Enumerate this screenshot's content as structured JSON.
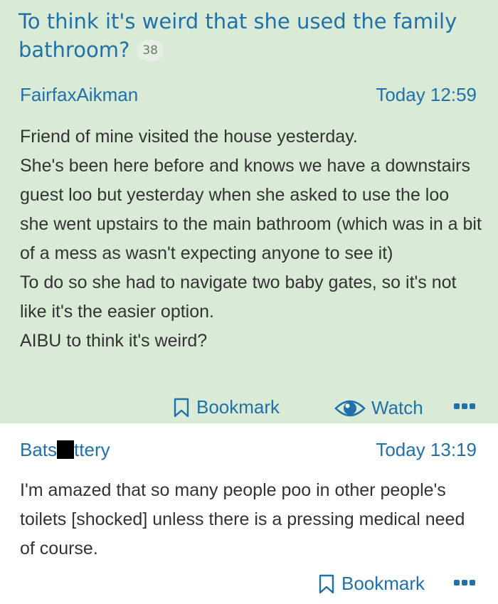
{
  "thread": {
    "title": "To think it's weird that she used the family bathroom?",
    "reply_count": "38"
  },
  "op": {
    "author": "FairfaxAikman",
    "time": "Today 12:59",
    "body_lines": [
      "Friend of mine visited the house yesterday.",
      "She's been here before and knows we have a downstairs guest loo but yesterday when she asked to use the loo she went upstairs to the main bathroom (which was in a bit of a mess as wasn't expecting anyone to see it)",
      "To do so she had to navigate two baby gates, so it's not like it's the easier option.",
      "AIBU to think it's weird?"
    ],
    "bookmark_label": "Bookmark",
    "watch_label": "Watch"
  },
  "reply": {
    "author_start": "Bats",
    "author_end": "ttery",
    "time": "Today 13:19",
    "body": "I'm amazed that so many people poo in other people's toilets [shocked] unless there is a pressing medical need of course.",
    "bookmark_label": "Bookmark"
  },
  "colors": {
    "op_background": "#d9ebd6",
    "link_blue": "#2270a8",
    "body_text": "#333333"
  },
  "icons": [
    "bookmark-icon",
    "eye-icon",
    "more-options-icon"
  ]
}
